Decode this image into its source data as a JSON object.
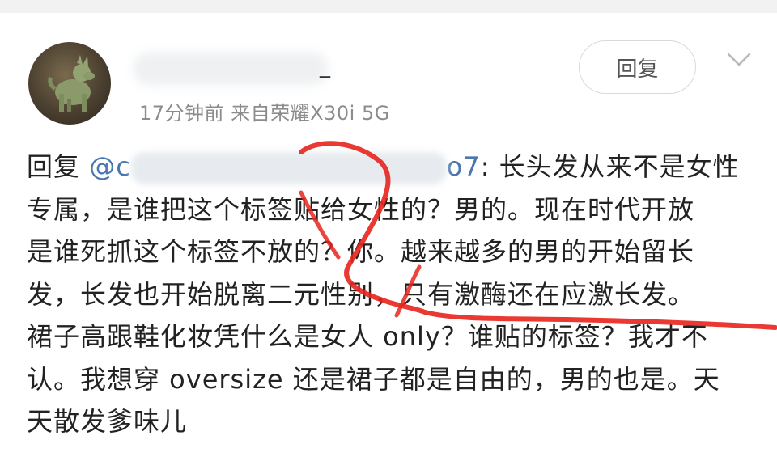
{
  "post": {
    "username_suffix": "_",
    "meta": "17分钟前  来自荣耀X30i 5G",
    "reply_button": "回复"
  },
  "comment": {
    "reply_prefix": "回复 ",
    "mention_start": "@c",
    "mention_end": "o7",
    "line1_rest": ": 长头发从来不是女性",
    "line2": "专属，是谁把这个标签贴给女性的？男的。现在时代开放",
    "line3": "是谁死抓这个标签不放的？你。越来越多的男的开始留长",
    "line4": "发，长发也开始脱离二元性别，只有激酶还在应激长发。",
    "line5": "裙子高跟鞋化妆凭什么是女人 only？谁贴的标签？我才不",
    "line6": "认。我想穿 oversize 还是裙子都是自由的，男的也是。天",
    "line7": "天散发爹味儿"
  },
  "colors": {
    "mention": "#4a77b0",
    "annotation_stroke": "#e8241d",
    "meta_text": "#8c8c8c"
  }
}
